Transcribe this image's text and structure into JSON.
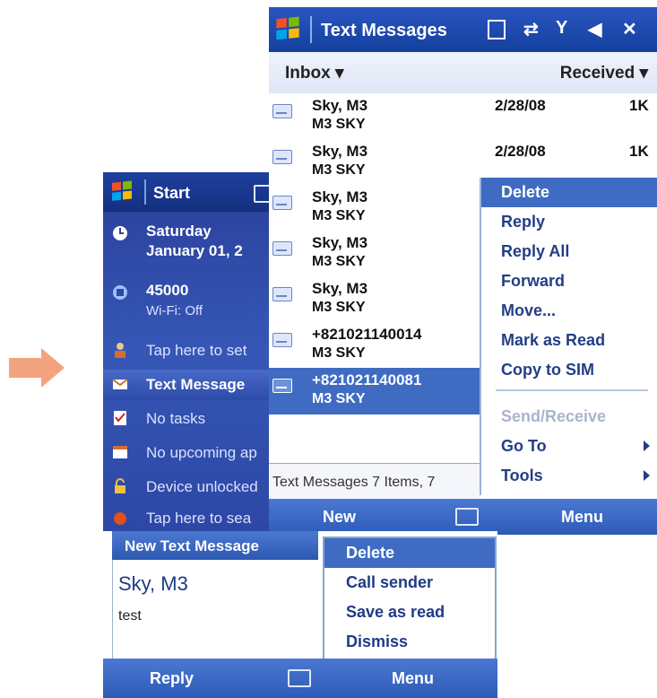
{
  "colors": {
    "arrow": "#f4a37f",
    "title_bar": "#1f4aa8",
    "selection": "#3f6cc2",
    "menu_text": "#223e86"
  },
  "today": {
    "title": "Start",
    "rows": [
      {
        "icon": "clock-icon",
        "line1": "Saturday",
        "line2": "January 01, 2"
      },
      {
        "icon": "network-icon",
        "line1": "45000",
        "line2": "Wi-Fi: Off"
      },
      {
        "icon": "owner-icon",
        "line1": "Tap here to set"
      },
      {
        "icon": "envelope-icon",
        "line1": "Text Message"
      },
      {
        "icon": "tasks-icon",
        "line1": "No tasks"
      },
      {
        "icon": "calendar-icon",
        "line1": "No upcoming ap"
      },
      {
        "icon": "lock-icon",
        "line1": "Device unlocked"
      },
      {
        "icon": "app-icon",
        "line1": "Tap here to sea"
      }
    ]
  },
  "sms": {
    "title": "Text Messages",
    "header": {
      "left": "Inbox ▾",
      "right": "Received ▾"
    },
    "messages": [
      {
        "from": "Sky, M3",
        "subject": "M3 SKY",
        "date": "2/28/08",
        "size": "1K"
      },
      {
        "from": "Sky, M3",
        "subject": "M3 SKY",
        "date": "2/28/08",
        "size": "1K"
      },
      {
        "from": "Sky, M3",
        "subject": "M3 SKY"
      },
      {
        "from": "Sky, M3",
        "subject": "M3 SKY"
      },
      {
        "from": "Sky, M3",
        "subject": "M3 SKY"
      },
      {
        "from": "+821021140014",
        "subject": "M3 SKY"
      },
      {
        "from": "+821021140081",
        "subject": "M3 SKY"
      }
    ],
    "status": "Text Messages  7 Items, 7",
    "softkeys": {
      "left": "New",
      "right": "Menu"
    },
    "menu": [
      "Delete",
      "Reply",
      "Reply All",
      "Forward",
      "Move...",
      "Mark as Read",
      "Copy to SIM",
      "Send/Receive",
      "Go To",
      "Tools"
    ]
  },
  "popup": {
    "title": "New Text Message",
    "from": "Sky, M3",
    "body": "test",
    "menu": [
      "Delete",
      "Call sender",
      "Save as read",
      "Dismiss"
    ],
    "softkeys": {
      "left": "Reply",
      "right": "Menu"
    }
  }
}
